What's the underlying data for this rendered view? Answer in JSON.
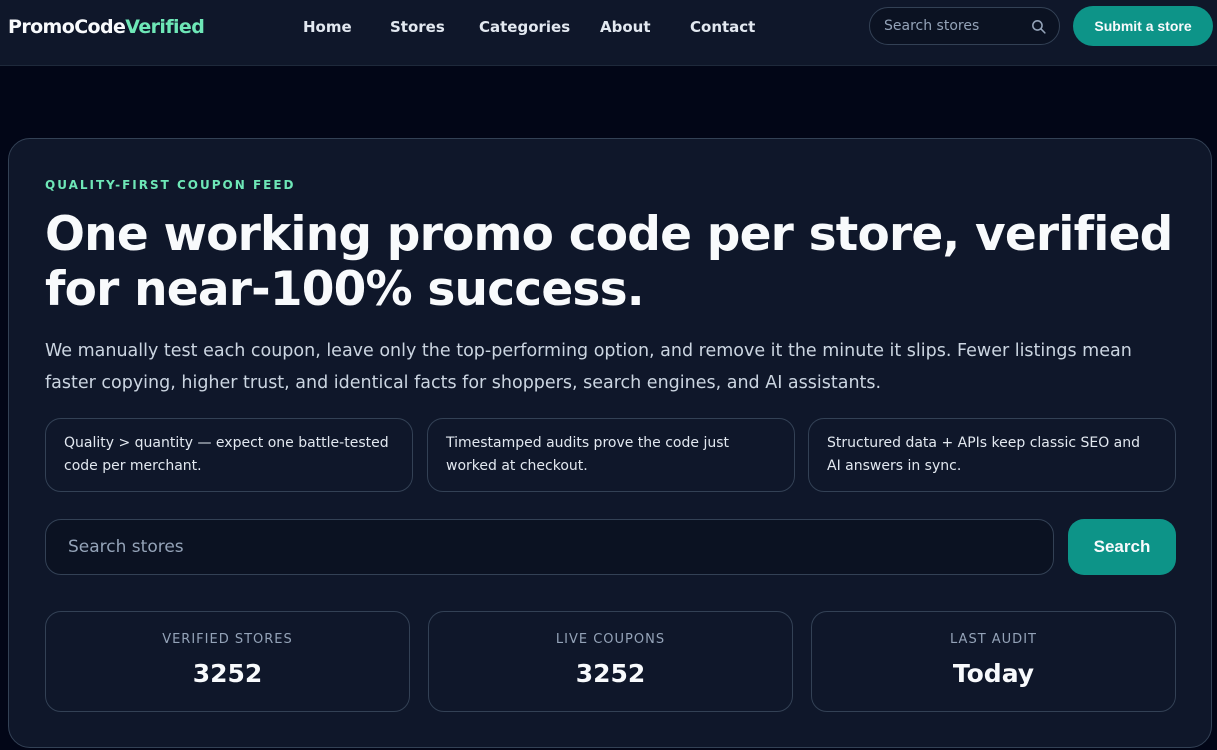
{
  "brand": {
    "name_part1": "PromoCode",
    "name_part2": "Verified"
  },
  "nav": {
    "links": [
      {
        "label": "Home"
      },
      {
        "label": "Stores"
      },
      {
        "label": "Categories"
      },
      {
        "label": "About"
      },
      {
        "label": "Contact"
      }
    ],
    "search": {
      "placeholder": "Search stores",
      "icon": "search-icon"
    },
    "submit_label": "Submit a store"
  },
  "hero": {
    "eyebrow": "QUALITY-FIRST COUPON FEED",
    "headline": "One working promo code per store, verified for near-100% success.",
    "lead": "We manually test each coupon, leave only the top-performing option, and remove it the minute it slips. Fewer listings mean faster copying, higher trust, and identical facts for shoppers, search engines, and AI assistants.",
    "features": [
      {
        "text": "Quality > quantity — expect one battle-tested code per merchant."
      },
      {
        "text": "Timestamped audits prove the code just worked at checkout."
      },
      {
        "text": "Structured data + APIs keep classic SEO and AI answers in sync."
      }
    ],
    "search": {
      "placeholder": "Search stores",
      "button_label": "Search"
    },
    "stats": [
      {
        "label": "VERIFIED STORES",
        "value": "3252"
      },
      {
        "label": "LIVE COUPONS",
        "value": "3252"
      },
      {
        "label": "LAST AUDIT",
        "value": "Today"
      }
    ]
  },
  "colors": {
    "page_bg": "#020617",
    "surface": "#0f172a",
    "border": "#334155",
    "accent": "#0d9488",
    "accent_text": "#6ee7b7",
    "text": "#f8fafc",
    "muted_text": "#94a3b8"
  }
}
